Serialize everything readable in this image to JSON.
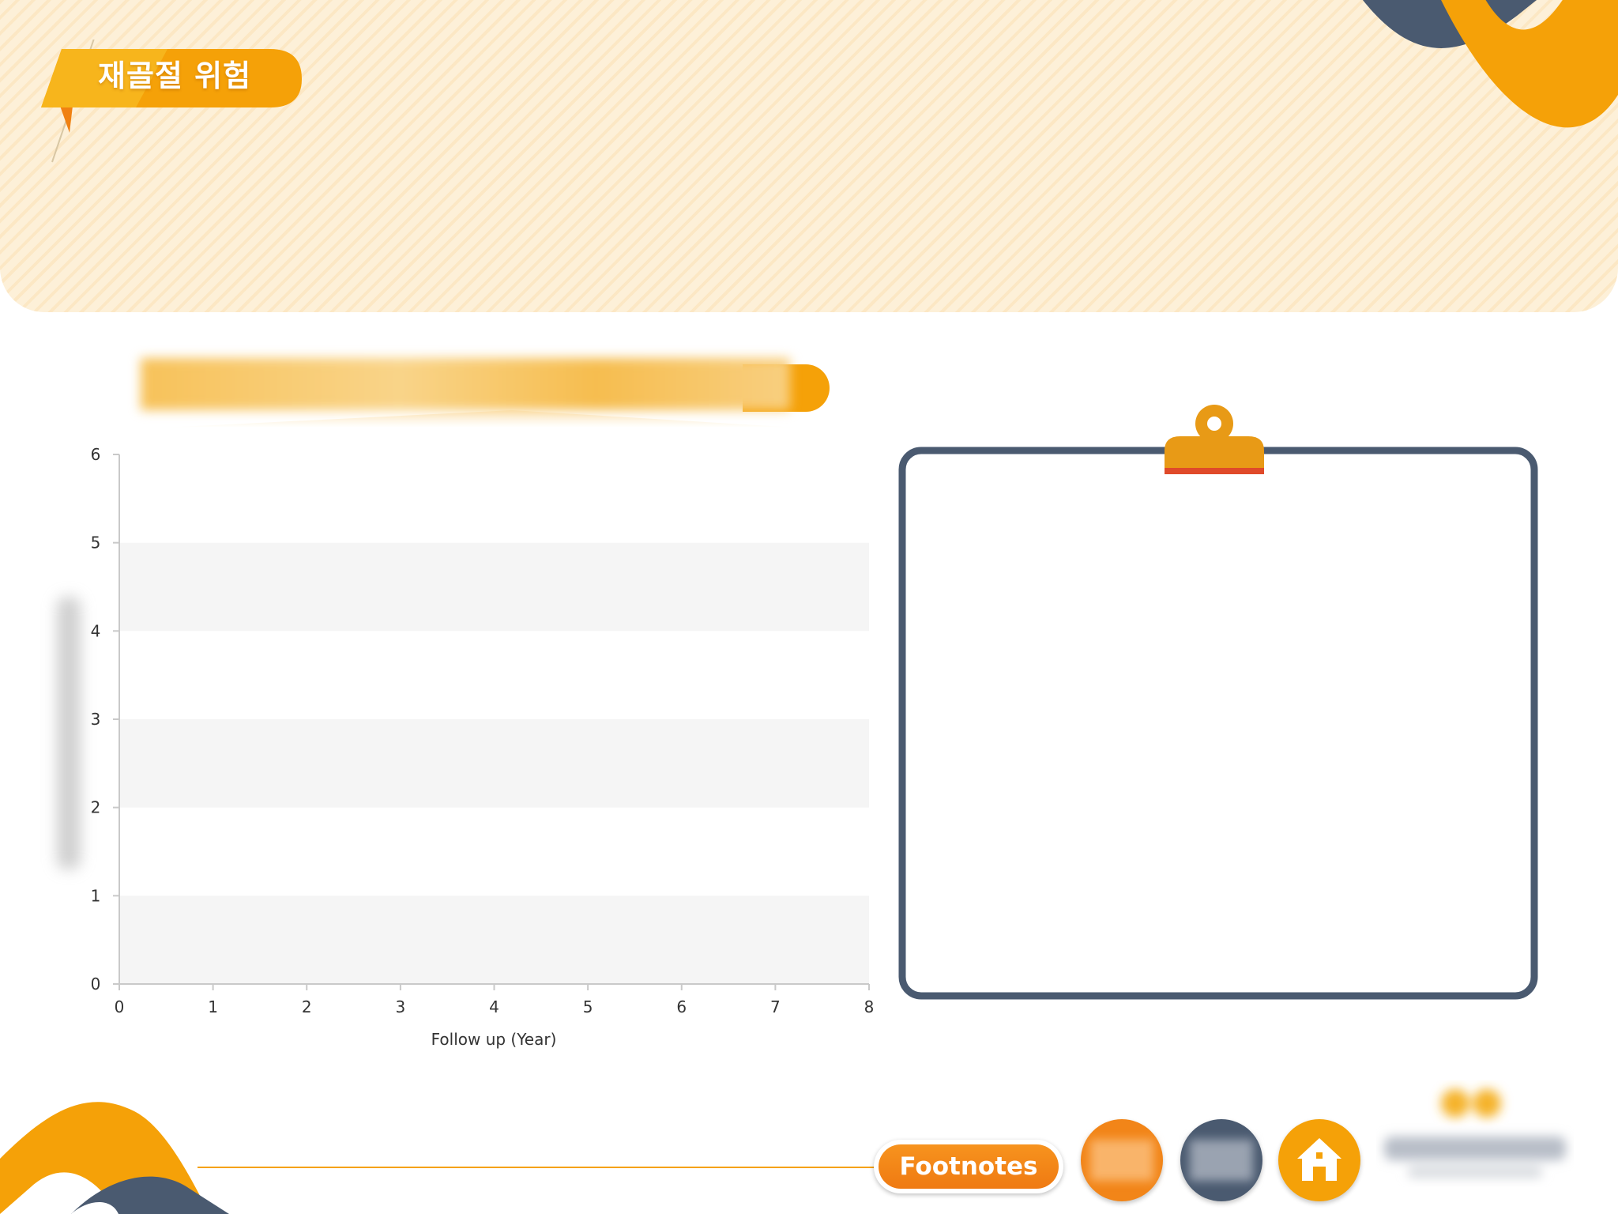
{
  "header": {
    "title": "재골절 위험"
  },
  "chart_data": {
    "type": "line",
    "x_label": "Follow up (Year)",
    "xlim": [
      0,
      8
    ],
    "ylim": [
      0,
      6
    ],
    "x_ticks": [
      "0",
      "1",
      "2",
      "3",
      "4",
      "5",
      "6",
      "7",
      "8"
    ],
    "y_ticks": [
      "0",
      "1",
      "2",
      "3",
      "4",
      "5",
      "6"
    ],
    "series": [],
    "grid": "alternating horizontal bands"
  },
  "footer": {
    "footnotes_label": "Footnotes"
  },
  "colors": {
    "accent_orange": "#f5a108",
    "slate": "#4a5a70",
    "panel_bg": "#fdf0d8",
    "footnotes_orange": "#f28518"
  },
  "icons": {
    "home": "home-icon",
    "clip": "clipboard-clip-icon"
  }
}
